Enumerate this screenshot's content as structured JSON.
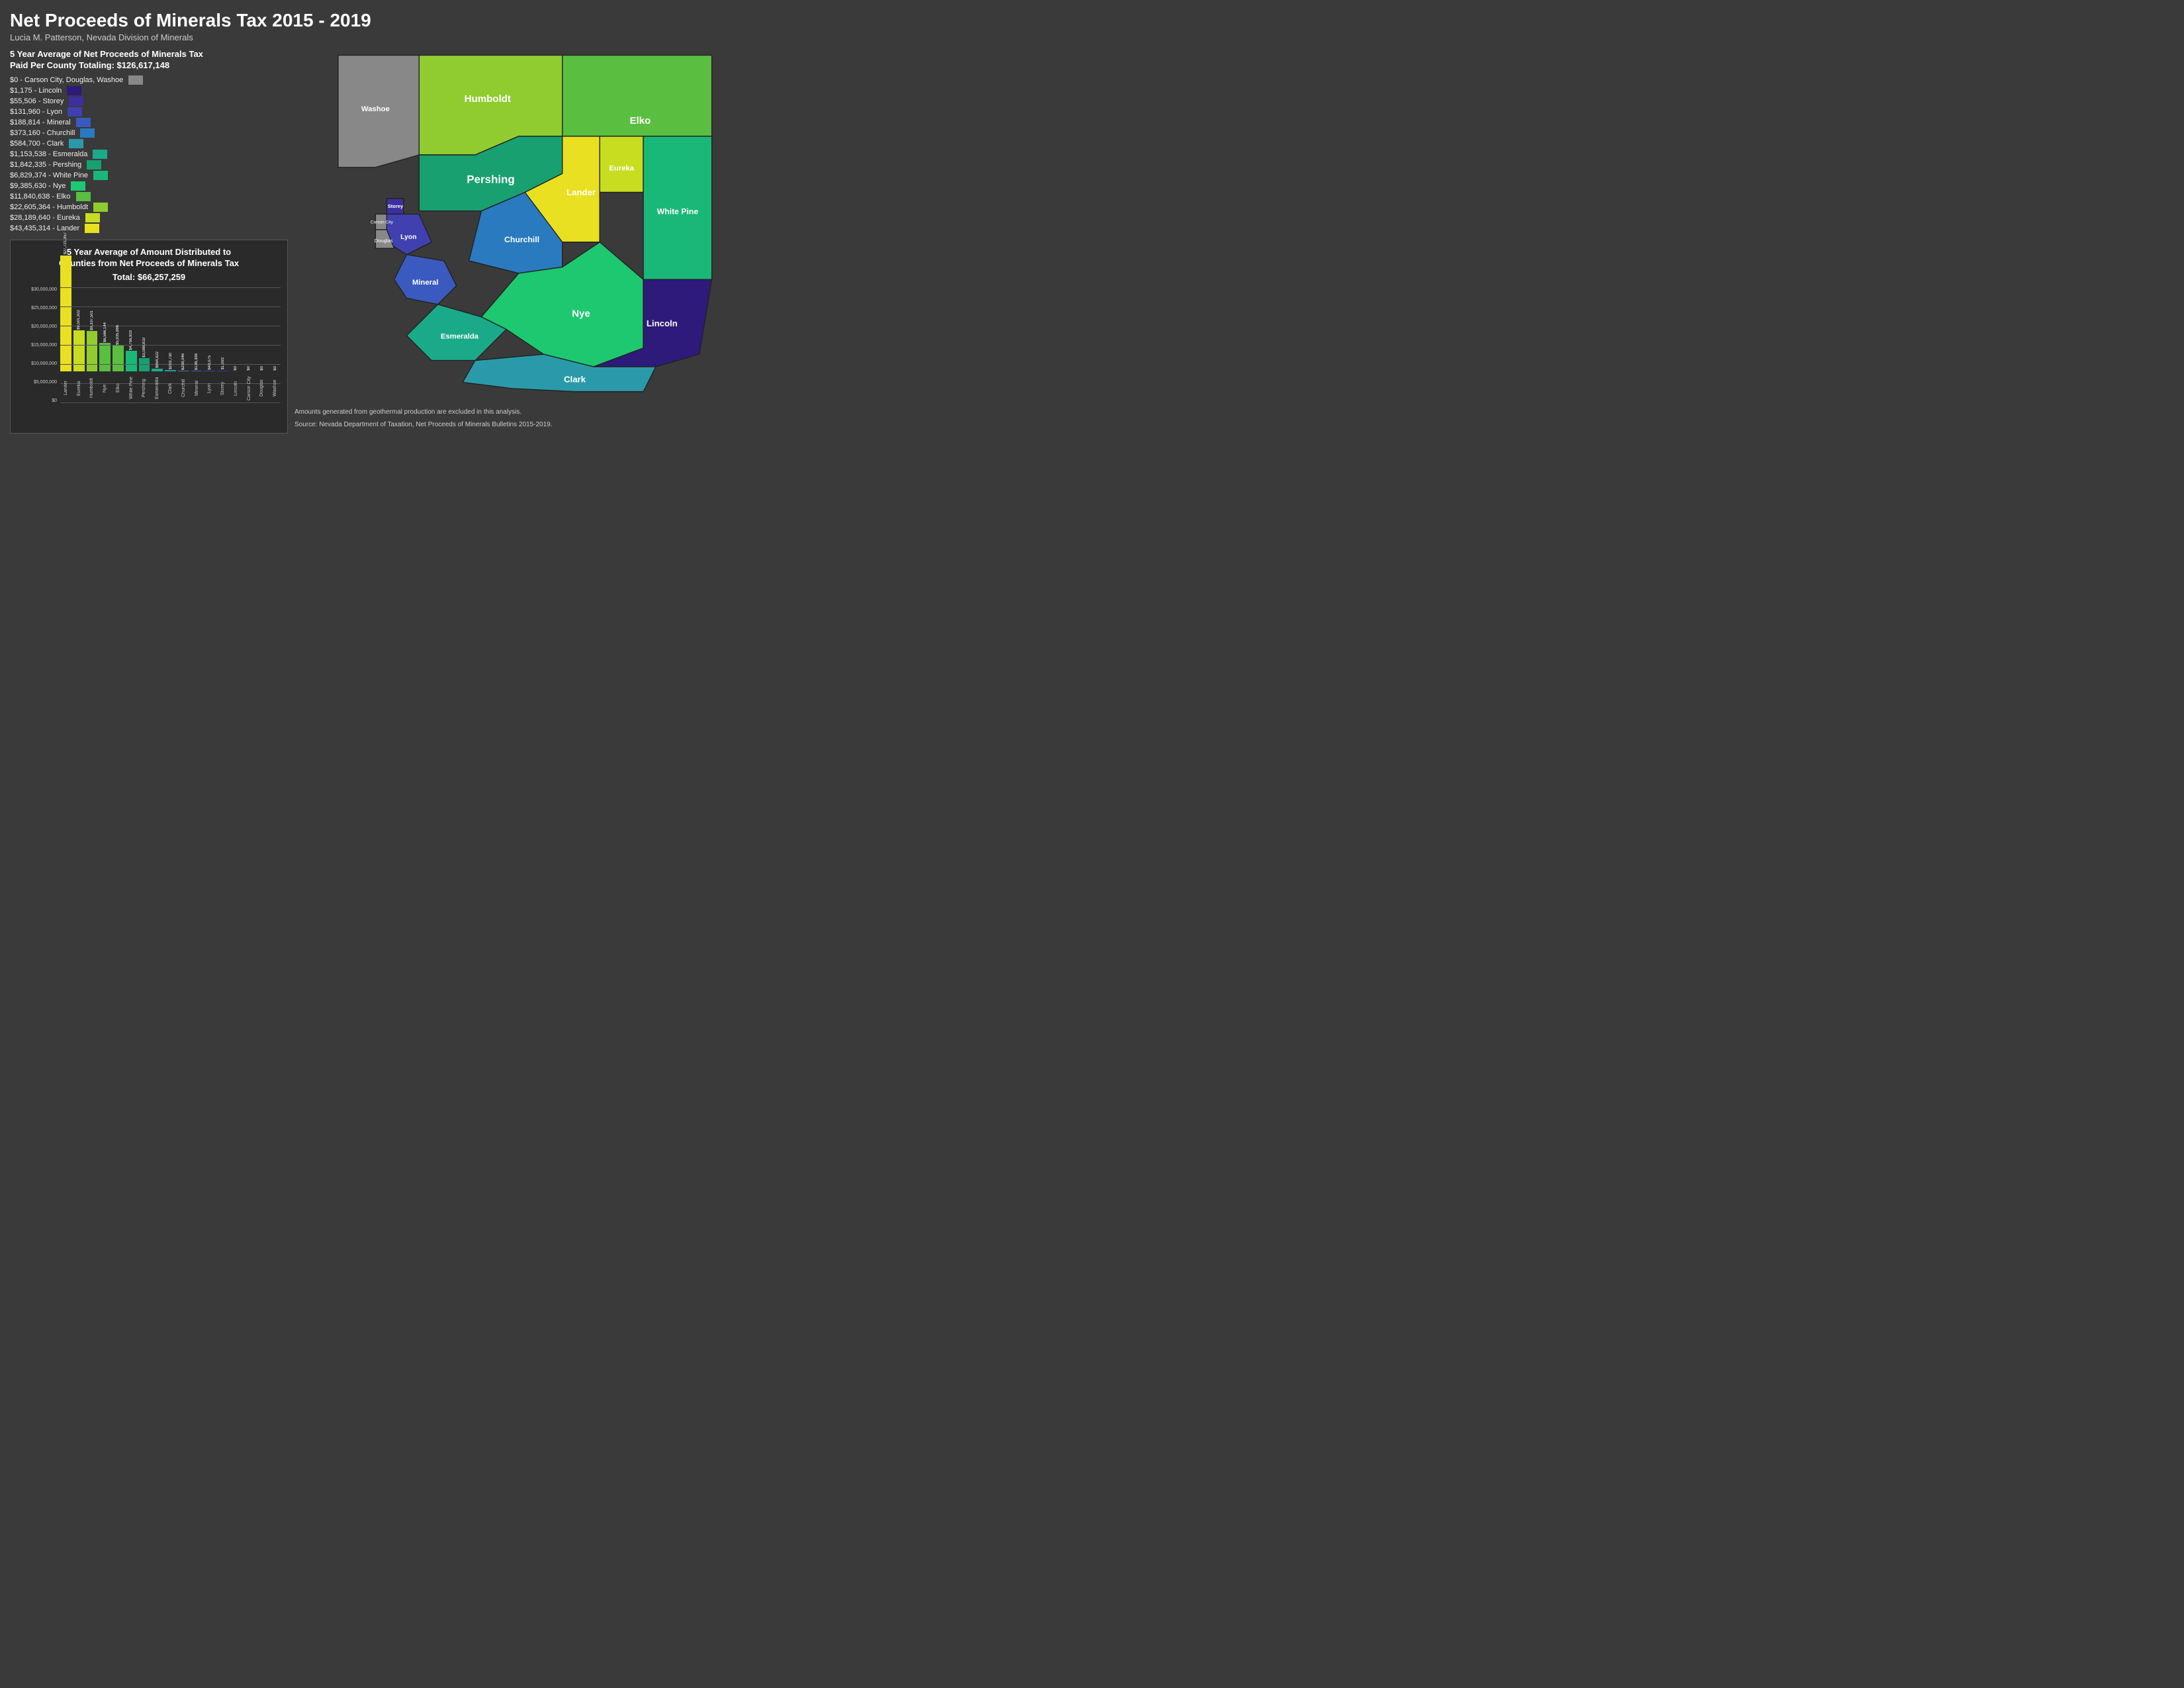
{
  "title": "Net Proceeds of Minerals Tax 2015 - 2019",
  "subtitle": "Lucia M. Patterson, Nevada Division of Minerals",
  "legend_title": "5 Year Average of Net Proceeds of Minerals Tax\nPaid Per County Totaling: $126,617,148",
  "legend_title_line1": "5 Year Average of Net Proceeds of Minerals Tax",
  "legend_title_line2": "Paid Per County Totaling: $126,617,148",
  "legend_items": [
    {
      "label": "$0 - Carson City, Douglas, Washoe",
      "color": "#888888"
    },
    {
      "label": "$1,175 - Lincoln",
      "color": "#2d1a7a"
    },
    {
      "label": "$55,506 - Storey",
      "color": "#3d2fa0"
    },
    {
      "label": "$131,960 - Lyon",
      "color": "#4040b0"
    },
    {
      "label": "$188,814 - Mineral",
      "color": "#3a5abf"
    },
    {
      "label": "$373,160 - Churchill",
      "color": "#2a7abf"
    },
    {
      "label": "$584,700 - Clark",
      "color": "#2a9aaa"
    },
    {
      "label": "$1,153,538 - Esmeralda",
      "color": "#1aaa8a"
    },
    {
      "label": "$1,842,335 - Pershing",
      "color": "#18a070"
    },
    {
      "label": "$6,829,374 - White Pine",
      "color": "#1ab878"
    },
    {
      "label": "$9,385,630 - Nye",
      "color": "#1dc870"
    },
    {
      "label": "$11,840,638 - Elko",
      "color": "#5abe40"
    },
    {
      "label": "$22,605,364 - Humboldt",
      "color": "#90cc30"
    },
    {
      "label": "$28,189,640 - Eureka",
      "color": "#c8dd20"
    },
    {
      "label": "$43,435,314 - Lander",
      "color": "#e8e020"
    }
  ],
  "chart_title_line1": "5 Year Average of Amount Distributed to",
  "chart_title_line2": "Counties from Net Proceeds of Minerals Tax",
  "chart_total": "Total: $66,257,259",
  "chart_bars": [
    {
      "label": "Lander",
      "value": "$27,721,957",
      "height": 175,
      "color": "#e8e020"
    },
    {
      "label": "Eureka",
      "value": "$9,501,922",
      "height": 62,
      "color": "#c8dd20"
    },
    {
      "label": "Humboldt",
      "value": "$9,337,501",
      "height": 61,
      "color": "#90cc30"
    },
    {
      "label": "Nye",
      "value": "$6,566,144",
      "height": 43,
      "color": "#5abe40"
    },
    {
      "label": "Elko",
      "value": "$5,935,886",
      "height": 39,
      "color": "#5abe40"
    },
    {
      "label": "White Pine",
      "value": "$4,756,903",
      "height": 31,
      "color": "#1ab878"
    },
    {
      "label": "Pershing",
      "value": "$3,088,819",
      "height": 20,
      "color": "#18a070"
    },
    {
      "label": "Esmeralda",
      "value": "$664,922",
      "height": 4,
      "color": "#1aaa8a"
    },
    {
      "label": "Clark",
      "value": "$293,730",
      "height": 2,
      "color": "#2a9aaa"
    },
    {
      "label": "Churchill",
      "value": "$208,046",
      "height": 1,
      "color": "#2a7abf"
    },
    {
      "label": "Mineral",
      "value": "$138,398",
      "height": 1,
      "color": "#3a5abf"
    },
    {
      "label": "Lyon",
      "value": "$43,075",
      "height": 1,
      "color": "#4040b0"
    },
    {
      "label": "Storey",
      "value": "$1,093",
      "height": 1,
      "color": "#3d2fa0"
    },
    {
      "label": "Lincoln",
      "value": "$0",
      "height": 0,
      "color": "#2d1a7a"
    },
    {
      "label": "Carson City",
      "value": "$0",
      "height": 0,
      "color": "#888888"
    },
    {
      "label": "Douglas",
      "value": "$0",
      "height": 0,
      "color": "#888888"
    },
    {
      "label": "Washoe",
      "value": "$0",
      "height": 0,
      "color": "#888888"
    }
  ],
  "y_axis_labels": [
    "$30,000,000",
    "$25,000,000",
    "$20,000,000",
    "$15,000,000",
    "$10,000,000",
    "$5,000,000",
    "$0"
  ],
  "notes_line1": "Amounts generated from geothermal production are excluded in this analysis.",
  "notes_line2": "Source: Nevada Department of Taxation, Net Proceeds of Minerals Bulletins 2015-2019.",
  "county_labels": {
    "humboldt": "Humboldt",
    "elko": "Elko",
    "pershing": "Pershing",
    "lander": "Lander",
    "eureka": "Eureka",
    "white_pine": "White Pine",
    "washoe": "Washoe",
    "storey": "Storey",
    "churchill": "Churchill",
    "lyon": "Lyon",
    "mineral": "Mineral",
    "nye": "Nye",
    "esmeralda": "Esmeralda",
    "clark": "Clark",
    "lincoln": "Lincoln",
    "carson_city": "Carson City",
    "douglas": "Douglas"
  }
}
